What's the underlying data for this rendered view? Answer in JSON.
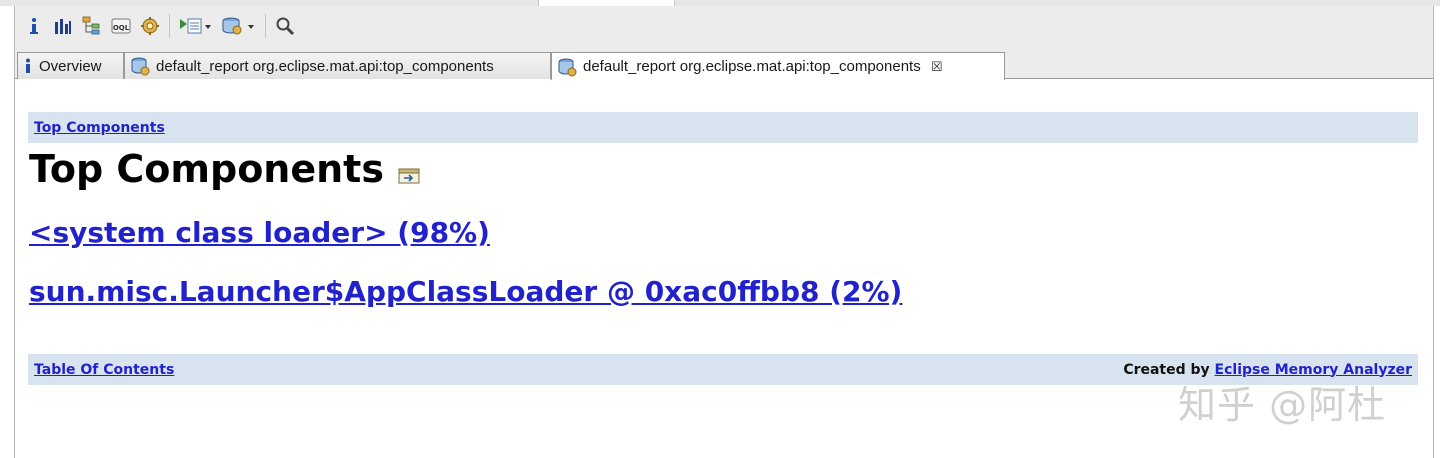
{
  "toolbar": {
    "buttons": [
      {
        "name": "info-icon",
        "glyph": "i"
      },
      {
        "name": "histogram-icon"
      },
      {
        "name": "dominator-tree-icon"
      },
      {
        "name": "oql-icon",
        "glyph": "OQL"
      },
      {
        "name": "thread-overview-icon"
      },
      {
        "name": "run-expert-system-icon"
      },
      {
        "name": "query-browser-icon"
      },
      {
        "name": "search-icon"
      }
    ]
  },
  "tabs": [
    {
      "label": "Overview",
      "icon": "info-icon"
    },
    {
      "label": "default_report  org.eclipse.mat.api:top_components",
      "icon": "report-icon"
    },
    {
      "label": "default_report  org.eclipse.mat.api:top_components",
      "icon": "report-icon",
      "active": true,
      "close": "☒"
    }
  ],
  "report": {
    "breadcrumb": "Top Components",
    "title": "Top Components",
    "links": [
      "<system class loader> (98%)",
      "sun.misc.Launcher$AppClassLoader @ 0xac0ffbb8 (2%)"
    ],
    "footer": {
      "toc_link": "Table Of Contents",
      "created_by": "Created by",
      "created_by_link": "Eclipse Memory Analyzer"
    }
  },
  "watermark": "知乎 @阿杜",
  "colors": {
    "link": "#2222cc",
    "bar_background": "#d7e4ef",
    "toolbar_background": "#ececec"
  }
}
